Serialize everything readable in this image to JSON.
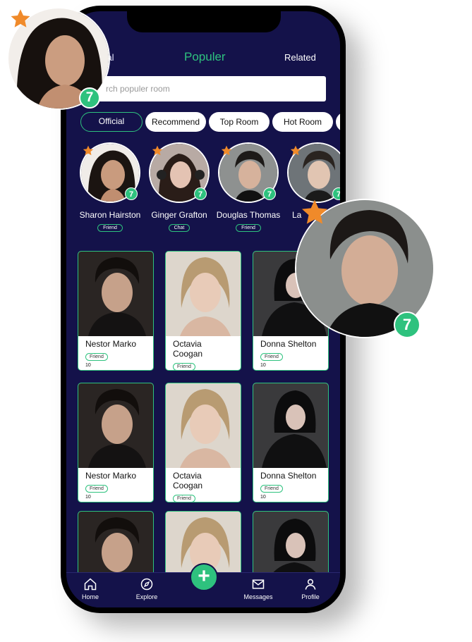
{
  "colors": {
    "background": "#14124a",
    "accent": "#2ec27e",
    "star": "#f08a2a"
  },
  "top_tabs": {
    "global": "lobal",
    "populer": "Populer",
    "related": "Related"
  },
  "search": {
    "placeholder": "rch populer room"
  },
  "chips": [
    "Official",
    "Recommend",
    "Top Room",
    "Hot Room"
  ],
  "stories": [
    {
      "name": "Sharon Hairston",
      "tag": "Friend",
      "badge": "7"
    },
    {
      "name": "Ginger Grafton",
      "tag": "Chat",
      "badge": "7"
    },
    {
      "name": "Douglas Thomas",
      "tag": "Friend",
      "badge": "7"
    },
    {
      "name": "La",
      "badge": "7"
    }
  ],
  "cards": [
    {
      "name": "Nestor Marko",
      "tag": "Friend",
      "count": "10"
    },
    {
      "name": "Octavia Coogan",
      "tag": "Friend",
      "count": "10"
    },
    {
      "name": "Donna Shelton",
      "tag": "Friend",
      "count": "10"
    },
    {
      "name": "Nestor Marko",
      "tag": "Friend",
      "count": "10"
    },
    {
      "name": "Octavia Coogan",
      "tag": "Friend",
      "count": "10"
    },
    {
      "name": "Donna Shelton",
      "tag": "Friend",
      "count": "10"
    }
  ],
  "bottom_nav": {
    "home": "Home",
    "explore": "Explore",
    "messages": "Messages",
    "profile": "Profile",
    "add": "+"
  },
  "floating": {
    "left_badge": "7",
    "right_badge": "7"
  }
}
